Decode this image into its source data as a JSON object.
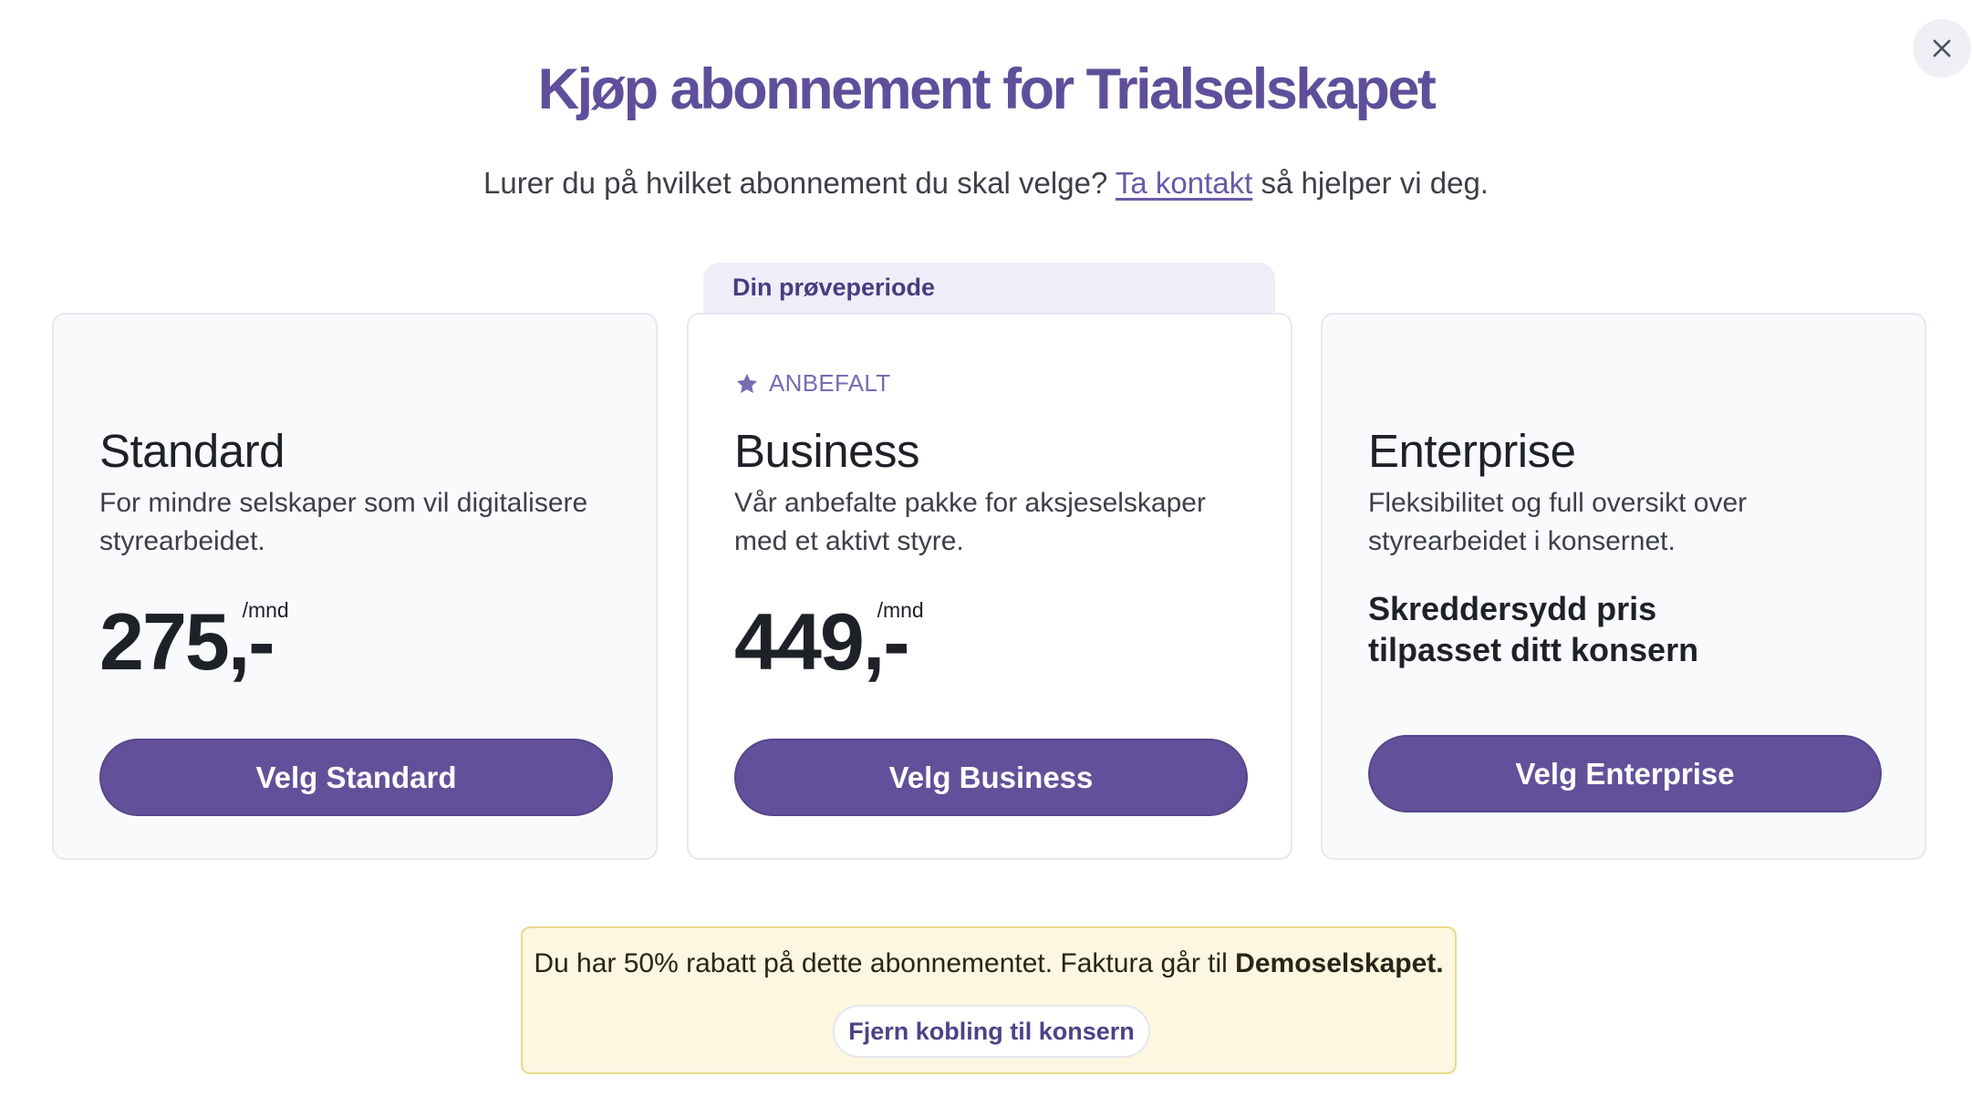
{
  "dialog": {
    "title": "Kjøp abonnement for Trialselskapet",
    "subtitle_before": "Lurer du på hvilket abonnement du skal velge?",
    "subtitle_link": "Ta kontakt",
    "subtitle_after": "så hjelper vi deg.",
    "close_icon": "close-icon"
  },
  "trial_tab": "Din prøveperiode",
  "plans": [
    {
      "name": "Standard",
      "description": "For mindre selskaper som vil digitalisere styrearbeidet.",
      "price": "275,-",
      "unit": "/mnd",
      "button": "Velg Standard"
    },
    {
      "badge": "ANBEFALT",
      "badge_icon": "star-icon",
      "name": "Business",
      "description": "Vår anbefalte pakke for aksjeselskaper med et aktivt styre.",
      "price": "449,-",
      "unit": "/mnd",
      "button": "Velg Business"
    },
    {
      "name": "Enterprise",
      "description": "Fleksibilitet og full oversikt over styrearbeidet i konsernet.",
      "custom_price_line1": "Skreddersydd pris",
      "custom_price_line2": "tilpasset ditt konsern",
      "button": "Velg Enterprise"
    }
  ],
  "notice": {
    "text": "Du har 50% rabatt på dette abonnementet. Faktura går til",
    "company": "Demoselskapet.",
    "button": "Fjern kobling til konsern"
  },
  "colors": {
    "brand_purple": "#62519a",
    "title_purple": "#5f4f9b",
    "notice_bg": "#fdf7e1",
    "notice_border": "#ead88a"
  }
}
